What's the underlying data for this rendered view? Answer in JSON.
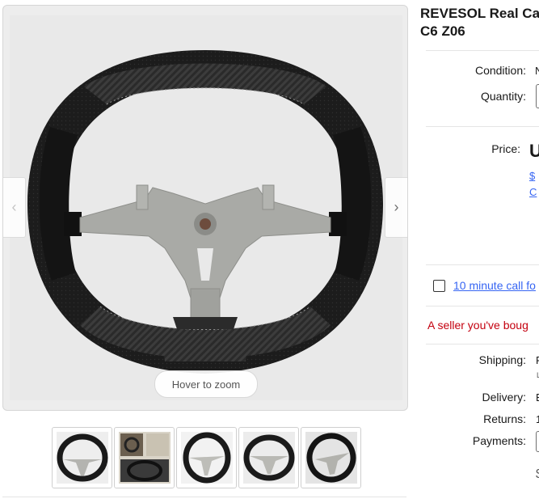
{
  "gallery": {
    "zoom_hint": "Hover to zoom",
    "prev_arrow": "‹",
    "next_arrow": "›",
    "thumbnails": [
      {
        "name": "thumb-1"
      },
      {
        "name": "thumb-2"
      },
      {
        "name": "thumb-3"
      },
      {
        "name": "thumb-4"
      },
      {
        "name": "thumb-5"
      }
    ]
  },
  "listing": {
    "title_line1": "REVESOL Real Ca",
    "title_line2": "C6 Z06",
    "condition_label": "Condition:",
    "condition_value": "N",
    "quantity_label": "Quantity:",
    "price_label": "Price:",
    "price_value": "U",
    "price_link1": "$",
    "price_link2": "C",
    "call_checkbox_label": "10 minute call fo",
    "alert_text": "A seller you've boug",
    "shipping_label": "Shipping:",
    "shipping_value": "F",
    "shipping_sub": "L",
    "delivery_label": "Delivery:",
    "delivery_value": "E",
    "returns_label": "Returns:",
    "returns_value": "1",
    "payments_label": "Payments:",
    "payments_value": "$"
  },
  "colors": {
    "link": "#3665f3",
    "alert": "#c4000f",
    "text": "#191919"
  }
}
